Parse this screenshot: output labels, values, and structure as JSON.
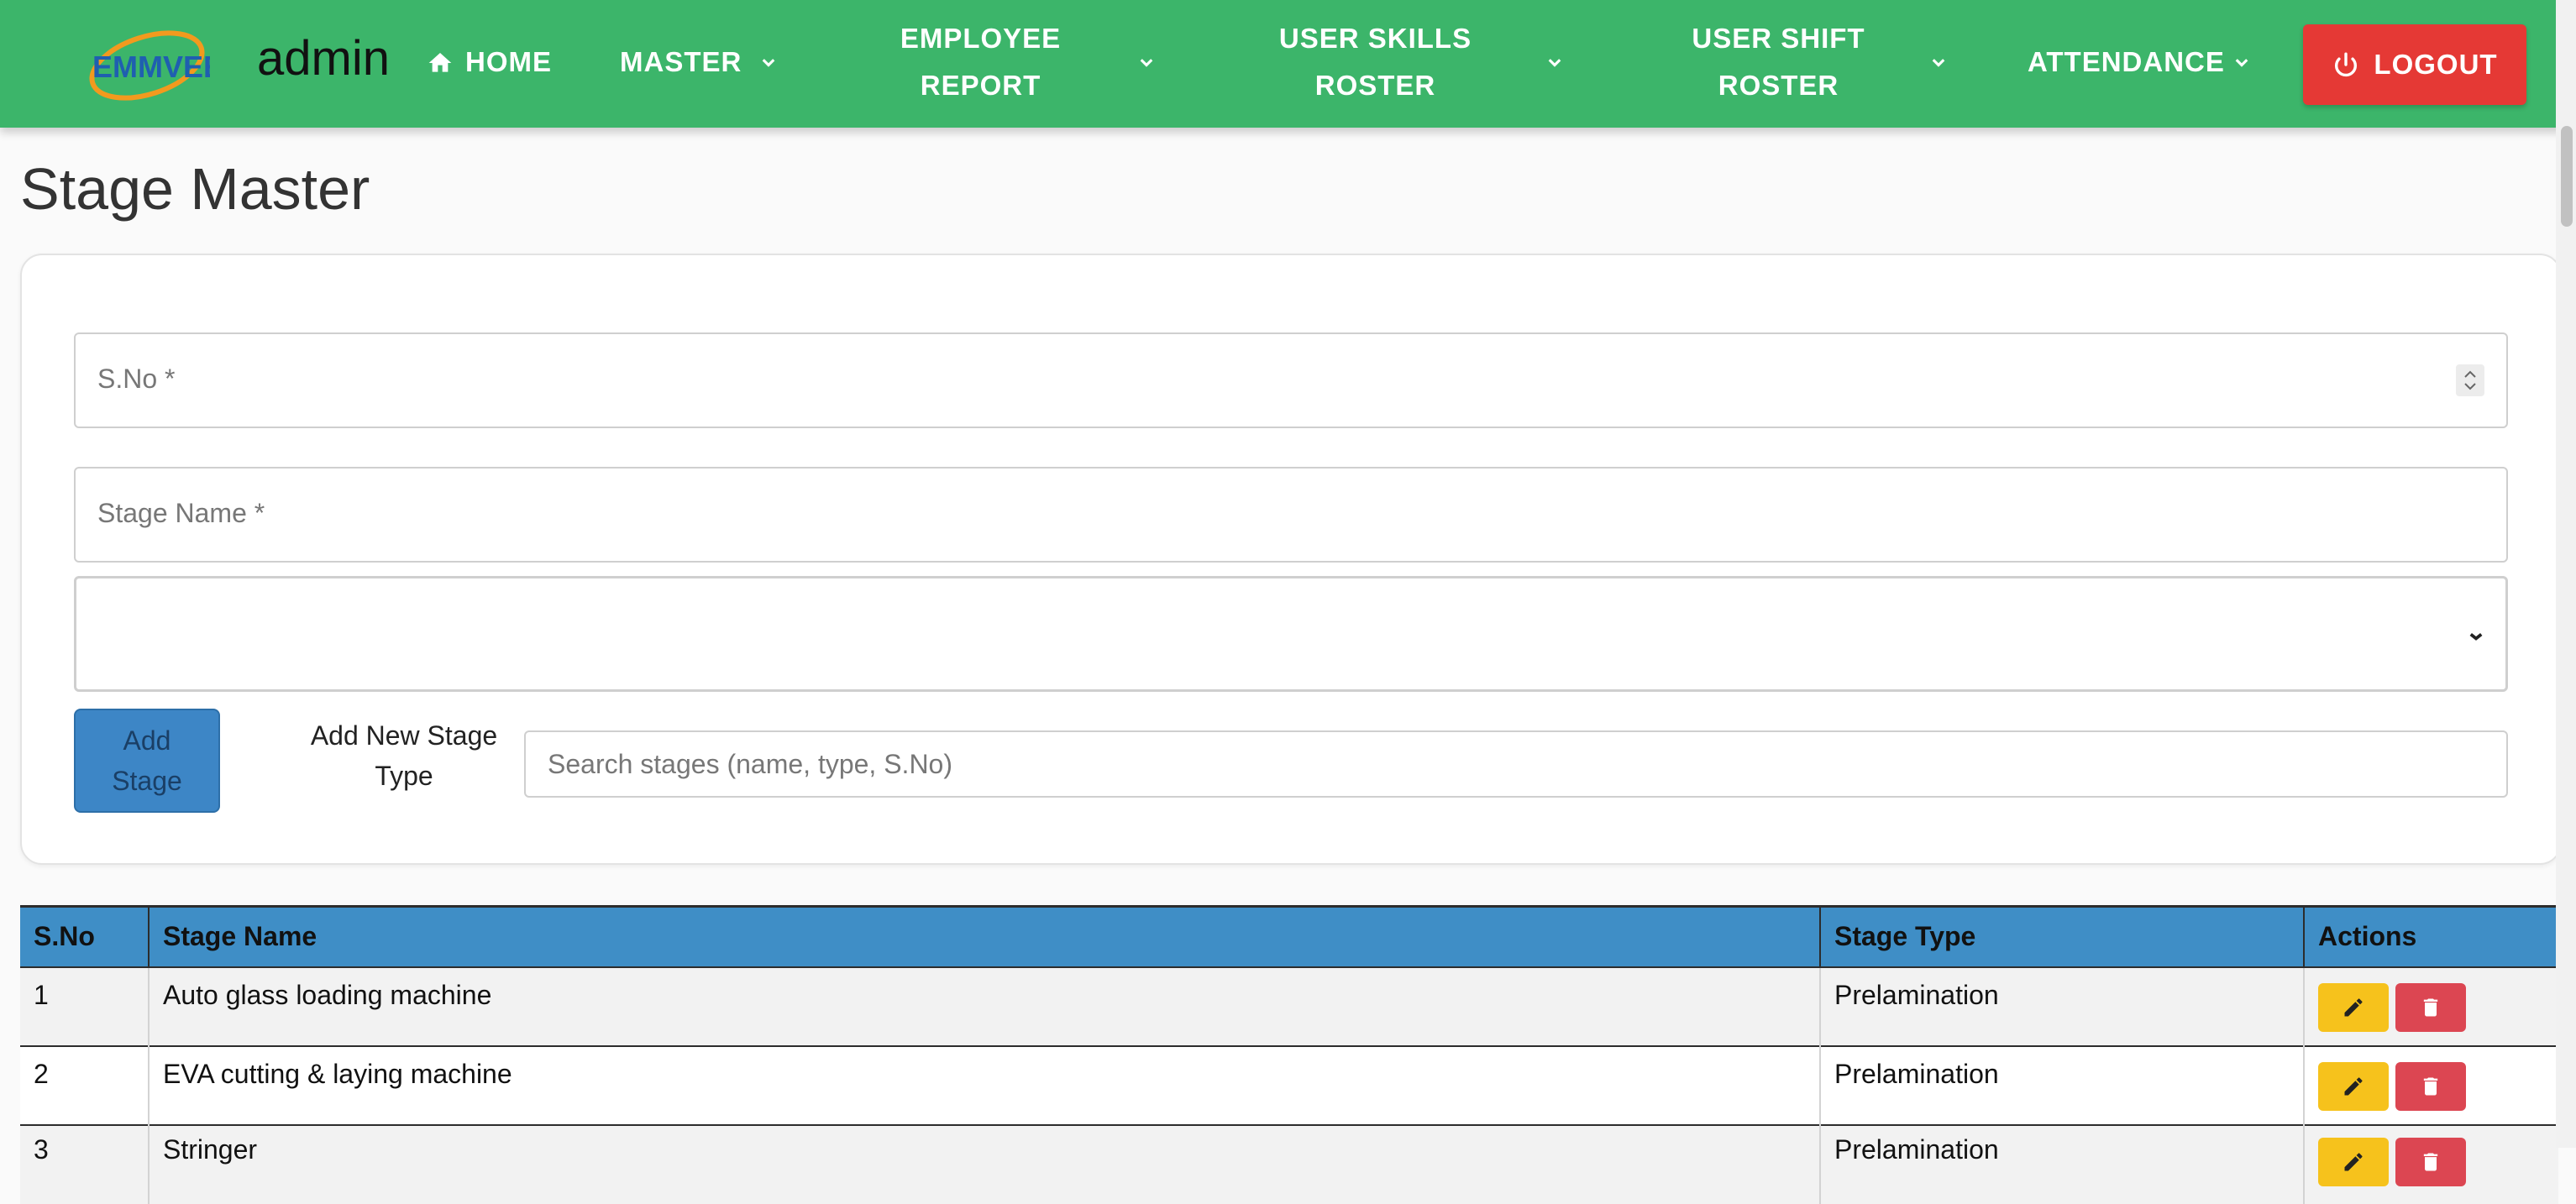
{
  "navbar": {
    "logo_text": "EMMVEE",
    "brand": "admin",
    "home_label": "HOME",
    "master_label": "MASTER",
    "employee_report_line1": "EMPLOYEE",
    "employee_report_line2": "REPORT",
    "user_skills_line1": "USER SKILLS",
    "user_skills_line2": "ROSTER",
    "user_shift_line1": "USER SHIFT",
    "user_shift_line2": "ROSTER",
    "attendance_label": "ATTENDANCE",
    "logout_label": "LOGOUT",
    "bg_color": "#3cb56a",
    "logout_color": "#e53935"
  },
  "page": {
    "title": "Stage Master"
  },
  "form": {
    "sno_placeholder": "S.No *",
    "stage_name_placeholder": "Stage Name *",
    "stage_type_value": "",
    "add_stage_line1": "Add",
    "add_stage_line2": "Stage",
    "add_new_type_line1": "Add New Stage",
    "add_new_type_line2": "Type",
    "search_placeholder": "Search stages (name, type, S.No)",
    "search_value": ""
  },
  "table": {
    "headers": {
      "sno": "S.No",
      "name": "Stage Name",
      "type": "Stage Type",
      "actions": "Actions"
    },
    "header_color": "#3f8ec6",
    "rows": [
      {
        "sno": "1",
        "name": "Auto glass loading machine",
        "type": "Prelamination"
      },
      {
        "sno": "2",
        "name": "EVA cutting & laying machine",
        "type": "Prelamination"
      },
      {
        "sno": "3",
        "name": "Stringer",
        "type": "Prelamination"
      }
    ]
  }
}
